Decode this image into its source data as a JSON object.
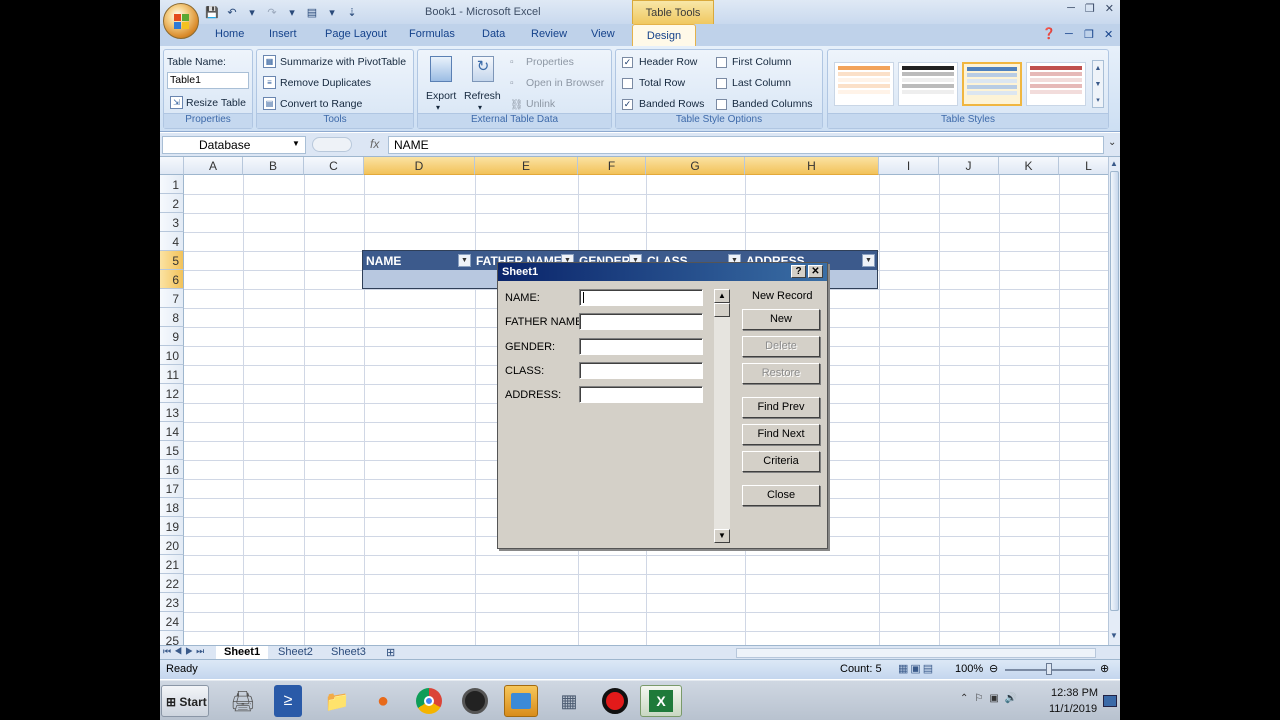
{
  "window": {
    "title": "Book1 - Microsoft Excel",
    "contextual_tab": "Table Tools"
  },
  "tabs": [
    "Home",
    "Insert",
    "Page Layout",
    "Formulas",
    "Data",
    "Review",
    "View"
  ],
  "active_tab": "Design",
  "ribbon": {
    "properties": {
      "table_name_label": "Table Name:",
      "table_name_value": "Table1",
      "resize": "Resize Table",
      "group": "Properties"
    },
    "tools": {
      "summarize": "Summarize with PivotTable",
      "remove_dup": "Remove Duplicates",
      "convert": "Convert to Range",
      "group": "Tools"
    },
    "external": {
      "export": "Export",
      "refresh": "Refresh",
      "properties": "Properties",
      "open_browser": "Open in Browser",
      "unlink": "Unlink",
      "group": "External Table Data"
    },
    "style_options": {
      "header_row": "Header Row",
      "total_row": "Total Row",
      "banded_rows": "Banded Rows",
      "first_column": "First Column",
      "last_column": "Last Column",
      "banded_columns": "Banded Columns",
      "group": "Table Style Options"
    },
    "styles_group": "Table Styles"
  },
  "formula_bar": {
    "name_box": "Database",
    "fx": "fx",
    "formula": "NAME"
  },
  "columns": [
    "A",
    "B",
    "C",
    "D",
    "E",
    "F",
    "G",
    "H",
    "I",
    "J",
    "K",
    "L"
  ],
  "rows": [
    "1",
    "2",
    "3",
    "4",
    "5",
    "6",
    "7",
    "8",
    "9",
    "10",
    "11",
    "12",
    "13",
    "14",
    "15",
    "16",
    "17",
    "18",
    "19",
    "20",
    "21",
    "22",
    "23",
    "24",
    "25"
  ],
  "table_headers": [
    "NAME",
    "FATHER NAME",
    "GENDER",
    "CLASS",
    "ADDRESS"
  ],
  "dialog": {
    "title": "Sheet1",
    "help": "?",
    "close_x": "✕",
    "fields": [
      "NAME:",
      "FATHER NAME:",
      "GENDER:",
      "CLASS:",
      "ADDRESS:"
    ],
    "record_label": "New Record",
    "buttons": {
      "new": "New",
      "delete": "Delete",
      "restore": "Restore",
      "find_prev": "Find Prev",
      "find_next": "Find Next",
      "criteria": "Criteria",
      "close": "Close"
    }
  },
  "sheets": [
    "Sheet1",
    "Sheet2",
    "Sheet3"
  ],
  "status": {
    "ready": "Ready",
    "count": "Count: 5",
    "zoom": "100%"
  },
  "taskbar": {
    "start": "Start",
    "time": "12:38 PM",
    "date": "11/1/2019"
  }
}
